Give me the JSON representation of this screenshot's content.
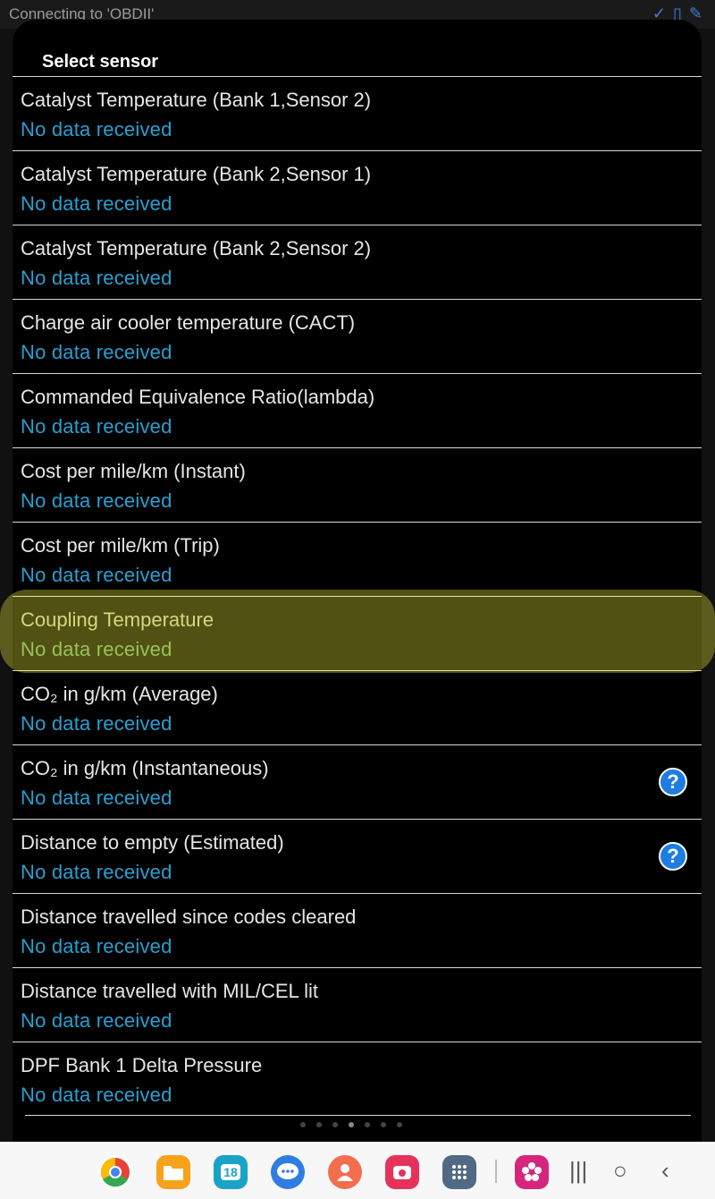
{
  "status_bar": {
    "text": "Connecting to 'OBDII'"
  },
  "dialog": {
    "title": "Select sensor",
    "items": [
      {
        "name": "Catalyst Temperature (Bank 1,Sensor 2)",
        "value": "No data received"
      },
      {
        "name": "Catalyst Temperature (Bank 2,Sensor 1)",
        "value": "No data received"
      },
      {
        "name": "Catalyst Temperature (Bank 2,Sensor 2)",
        "value": "No data received"
      },
      {
        "name": "Charge air cooler temperature (CACT)",
        "value": "No data received"
      },
      {
        "name": "Commanded Equivalence Ratio(lambda)",
        "value": "No data received"
      },
      {
        "name": "Cost per mile/km (Instant)",
        "value": "No data received"
      },
      {
        "name": "Cost per mile/km (Trip)",
        "value": "No data received"
      },
      {
        "name": "Coupling Temperature",
        "value": "No data received"
      },
      {
        "name": "CO₂ in g/km (Average)",
        "value": "No data received"
      },
      {
        "name": "CO₂ in g/km (Instantaneous)",
        "value": "No data received",
        "help": "?"
      },
      {
        "name": "Distance to empty (Estimated)",
        "value": "No data received",
        "help": "?"
      },
      {
        "name": "Distance travelled since codes cleared",
        "value": "No data received"
      },
      {
        "name": "Distance travelled with MIL/CEL lit",
        "value": "No data received"
      },
      {
        "name": "DPF Bank 1 Delta Pressure",
        "value": "No data received"
      }
    ]
  },
  "taskbar": {
    "apps": [
      {
        "icon": "chrome-icon",
        "color": "#e94235"
      },
      {
        "icon": "folder-icon",
        "color": "#f7a21b"
      },
      {
        "icon": "calendar-icon",
        "color": "#1ba3c7",
        "label": "18"
      },
      {
        "icon": "messages-icon",
        "color": "#2f7de1"
      },
      {
        "icon": "contacts-icon",
        "color": "#f26e4f"
      },
      {
        "icon": "camera-icon",
        "color": "#e6325a"
      },
      {
        "icon": "apps-grid-icon",
        "color": "#4f6a85"
      },
      {
        "icon": "flower-app-icon",
        "color": "#d6267c"
      }
    ]
  },
  "colors": {
    "accent_value": "#28a0d2",
    "highlight": "#f5f53c",
    "help_icon": "#1d7de0"
  }
}
